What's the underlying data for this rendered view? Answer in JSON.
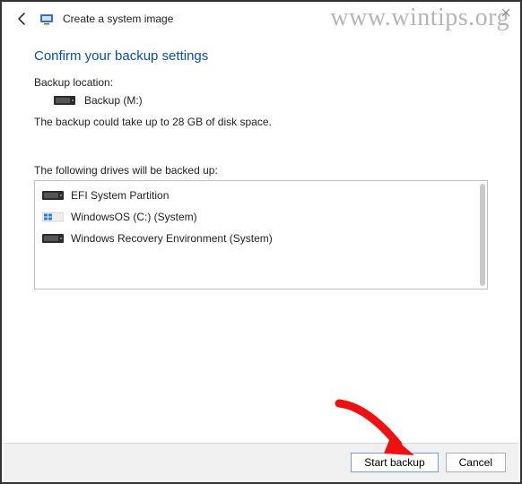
{
  "watermark": "www.wintips.org",
  "header": {
    "title": "Create a system image"
  },
  "main": {
    "section_title": "Confirm your backup settings",
    "backup_location_label": "Backup location:",
    "backup_location_name": "Backup (M:)",
    "estimated_size": "The backup could take up to 28 GB of disk space.",
    "drives_label": "The following drives will be backed up:",
    "drives": [
      {
        "name": "EFI System Partition",
        "icon": "drive"
      },
      {
        "name": "WindowsOS (C:) (System)",
        "icon": "windows-drive"
      },
      {
        "name": "Windows Recovery Environment (System)",
        "icon": "drive"
      }
    ]
  },
  "footer": {
    "start_label": "Start backup",
    "cancel_label": "Cancel"
  }
}
